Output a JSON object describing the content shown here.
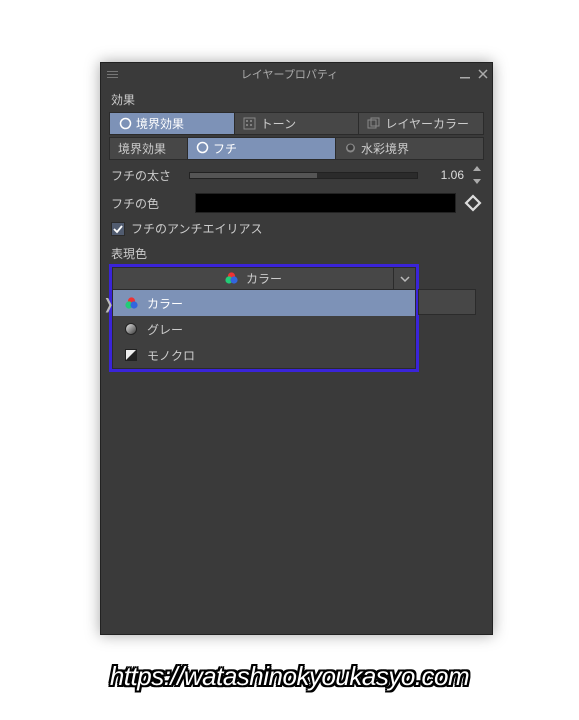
{
  "titlebar": {
    "title": "レイヤープロパティ"
  },
  "effects": {
    "label": "効果",
    "tabs": [
      {
        "label": "境界効果"
      },
      {
        "label": "トーン"
      },
      {
        "label": "レイヤーカラー"
      }
    ],
    "subtabs_lead": "境界効果",
    "subtabs": [
      {
        "label": "フチ"
      },
      {
        "label": "水彩境界"
      }
    ]
  },
  "thickness": {
    "label": "フチの太さ",
    "value": "1.06"
  },
  "edge_color": {
    "label": "フチの色"
  },
  "antialias": {
    "label": "フチのアンチエイリアス"
  },
  "expression": {
    "label": "表現色",
    "selected": "カラー",
    "options": [
      {
        "label": "カラー"
      },
      {
        "label": "グレー"
      },
      {
        "label": "モノクロ"
      }
    ]
  },
  "watermark": "https://watashinokyoukasyo.com"
}
